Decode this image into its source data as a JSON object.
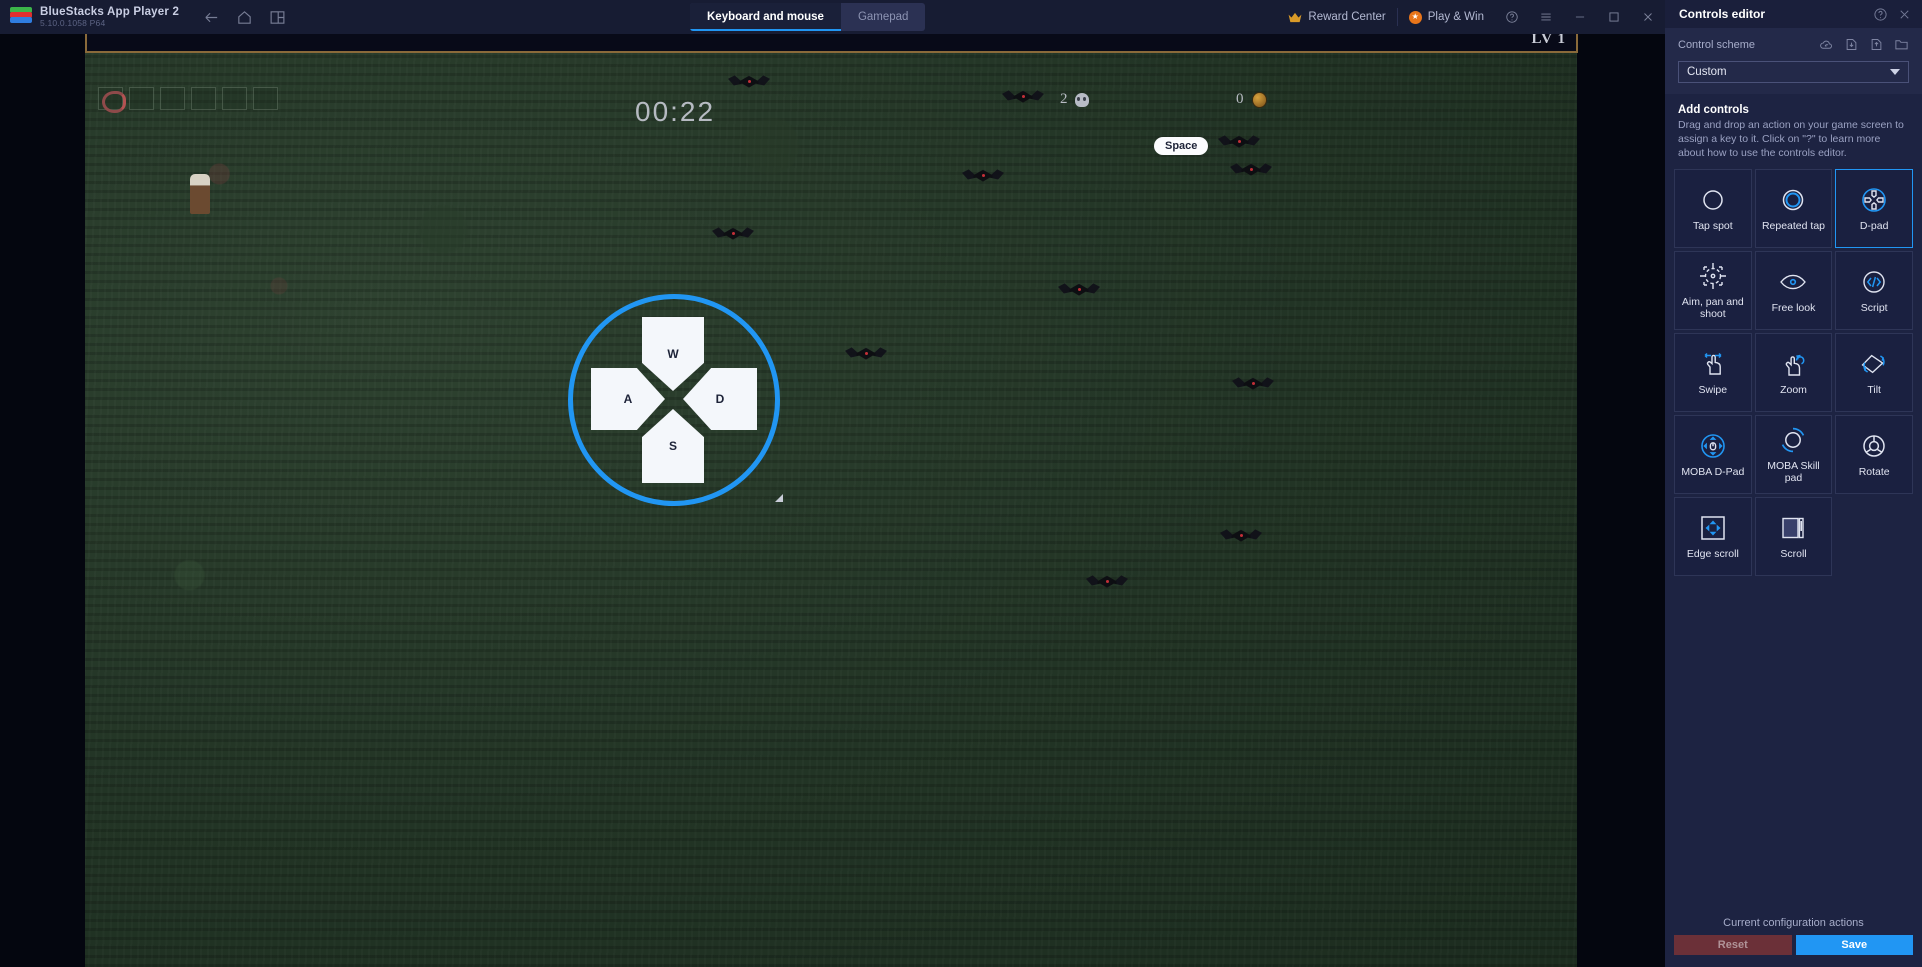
{
  "titlebar": {
    "app_name": "BlueStacks App Player 2",
    "app_version": "5.10.0.1058  P64",
    "nav": [
      {
        "name": "back-icon",
        "label": "Back"
      },
      {
        "name": "home-icon",
        "label": "Home"
      },
      {
        "name": "multi-instance-icon",
        "label": "Multi-instance"
      }
    ],
    "tabs": [
      {
        "label": "Keyboard and mouse",
        "active": true
      },
      {
        "label": "Gamepad",
        "active": false
      }
    ],
    "reward_center": "Reward Center",
    "play_and_win": "Play & Win",
    "window_controls": [
      "help-icon",
      "menu-icon",
      "minimize-icon",
      "maximize-icon",
      "close-icon"
    ]
  },
  "game": {
    "timer": "00:22",
    "level": "LV 1",
    "kill_count": "2",
    "coin_count": "0",
    "space_key_tag": "Space",
    "dpad_keys": {
      "up": "W",
      "left": "A",
      "down": "S",
      "right": "D"
    }
  },
  "panel": {
    "title": "Controls editor",
    "scheme_label": "Control scheme",
    "scheme_icons": [
      "cloud-sync-icon",
      "import-icon",
      "export-icon",
      "folder-icon"
    ],
    "scheme_selected": "Custom",
    "add_title": "Add controls",
    "add_description": "Drag and drop an action on your game screen to assign a key to it. Click on \"?\" to learn more about how to use the controls editor.",
    "controls": [
      {
        "label": "Tap spot",
        "icon": "tap-spot-icon",
        "selected": false
      },
      {
        "label": "Repeated tap",
        "icon": "repeated-tap-icon",
        "selected": false
      },
      {
        "label": "D-pad",
        "icon": "dpad-icon",
        "selected": true
      },
      {
        "label": "Aim, pan and shoot",
        "icon": "aim-pan-shoot-icon",
        "selected": false
      },
      {
        "label": "Free look",
        "icon": "free-look-icon",
        "selected": false
      },
      {
        "label": "Script",
        "icon": "script-icon",
        "selected": false
      },
      {
        "label": "Swipe",
        "icon": "swipe-icon",
        "selected": false
      },
      {
        "label": "Zoom",
        "icon": "zoom-icon",
        "selected": false
      },
      {
        "label": "Tilt",
        "icon": "tilt-icon",
        "selected": false
      },
      {
        "label": "MOBA D-Pad",
        "icon": "moba-dpad-icon",
        "selected": false
      },
      {
        "label": "MOBA Skill pad",
        "icon": "moba-skill-pad-icon",
        "selected": false
      },
      {
        "label": "Rotate",
        "icon": "rotate-icon",
        "selected": false
      },
      {
        "label": "Edge scroll",
        "icon": "edge-scroll-icon",
        "selected": false
      },
      {
        "label": "Scroll",
        "icon": "scroll-icon",
        "selected": false
      }
    ],
    "footer_title": "Current configuration actions",
    "reset_label": "Reset",
    "save_label": "Save"
  },
  "colors": {
    "accent": "#2196f3",
    "panel_bg": "#1d2342",
    "titlebar_bg": "#171c33",
    "reset_bg": "#6b3038"
  }
}
